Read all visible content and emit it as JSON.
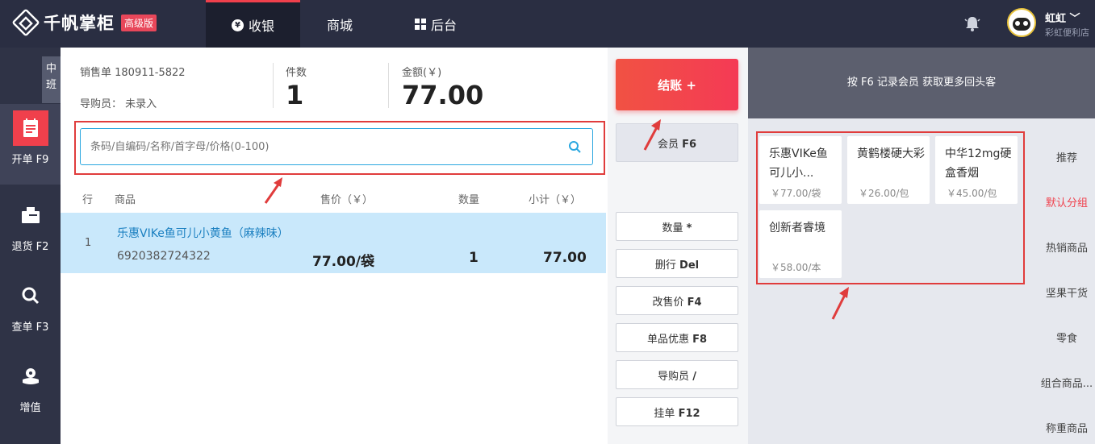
{
  "header": {
    "logo_text": "千帆掌柜",
    "edition_badge": "高级版",
    "nav": [
      {
        "label": "收银",
        "icon": "coin-icon",
        "active": true
      },
      {
        "label": "商城",
        "icon": "",
        "active": false
      },
      {
        "label": "后台",
        "icon": "grid-icon",
        "active": false
      }
    ],
    "user_name": "虹虹",
    "store_name": "彩虹便利店"
  },
  "sidebar": {
    "shift_label": "中班",
    "items": [
      {
        "label": "开单 F9",
        "icon": "receipt-icon",
        "active": true
      },
      {
        "label": "退货 F2",
        "icon": "box-return-icon",
        "active": false
      },
      {
        "label": "查单 F3",
        "icon": "search-icon",
        "active": false
      },
      {
        "label": "增值",
        "icon": "flower-icon",
        "active": false
      }
    ]
  },
  "order": {
    "sale_no_label": "销售单 180911-5822",
    "guide_label": "导购员：  未录入",
    "count_label": "件数",
    "count_value": "1",
    "amount_label": "金额(￥)",
    "amount_value": "77.00"
  },
  "search": {
    "placeholder": "条码/自编码/名称/首字母/价格(0-100)"
  },
  "table": {
    "headers": {
      "row": "行",
      "product": "商品",
      "price": "售价（￥）",
      "qty": "数量",
      "subtotal": "小计（￥）"
    },
    "rows": [
      {
        "idx": "1",
        "name": "乐惠VIKe鱼可儿小黄鱼（麻辣味）",
        "code": "6920382724322",
        "price": "77.00/袋",
        "qty": "1",
        "subtotal": "77.00"
      }
    ]
  },
  "actions": {
    "checkout": "结账 +",
    "member": "会员",
    "member_key": "F6",
    "buttons": [
      {
        "label": "数量",
        "key": "*"
      },
      {
        "label": "删行",
        "key": "Del"
      },
      {
        "label": "改售价",
        "key": "F4"
      },
      {
        "label": "单品优惠",
        "key": "F8"
      },
      {
        "label": "导购员",
        "key": "/"
      },
      {
        "label": "挂单",
        "key": "F12"
      }
    ]
  },
  "right_panel": {
    "promo": "按 F6 记录会员 获取更多回头客",
    "products": [
      {
        "name": "乐惠VIKe鱼可儿小...",
        "price": "￥77.00/袋"
      },
      {
        "name": "黄鹤楼硬大彩",
        "price": "￥26.00/包"
      },
      {
        "name": "中华12mg硬盒香烟",
        "price": "￥45.00/包"
      },
      {
        "name": "创新者睿境",
        "price": "￥58.00/本"
      }
    ],
    "categories": [
      {
        "label": "推荐",
        "active": false
      },
      {
        "label": "默认分组",
        "active": true
      },
      {
        "label": "热销商品",
        "active": false
      },
      {
        "label": "坚果干货",
        "active": false
      },
      {
        "label": "零食",
        "active": false
      },
      {
        "label": "组合商品...",
        "active": false
      },
      {
        "label": "称重商品",
        "active": false
      }
    ]
  },
  "colors": {
    "accent": "#f0404c",
    "topbar": "#2a2e42",
    "sidebar": "#2f3346",
    "highlight_row": "#c9e8fb",
    "link": "#1a7fc0"
  }
}
